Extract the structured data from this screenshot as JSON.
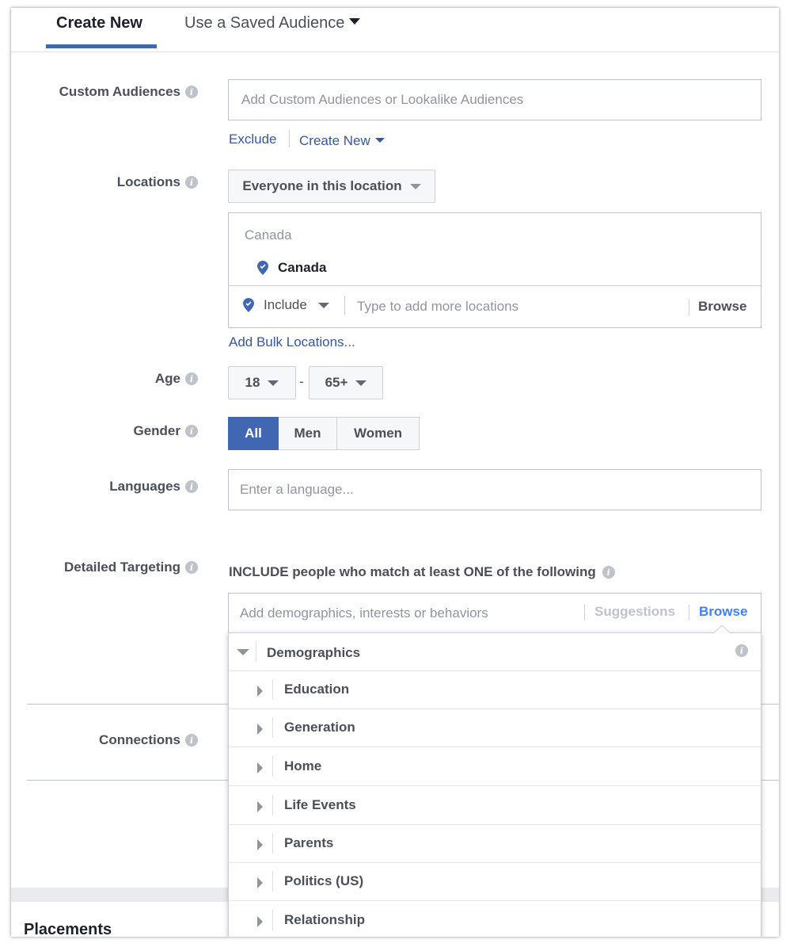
{
  "tabs": {
    "create_new": "Create New",
    "saved_audience": "Use a Saved Audience"
  },
  "custom_audiences": {
    "label": "Custom Audiences",
    "placeholder": "Add Custom Audiences or Lookalike Audiences",
    "exclude_link": "Exclude",
    "create_new_link": "Create New"
  },
  "locations": {
    "label": "Locations",
    "dropdown_value": "Everyone in this location",
    "group_header": "Canada",
    "selected_location": "Canada",
    "include_value": "Include",
    "input_placeholder": "Type to add more locations",
    "browse_label": "Browse",
    "bulk_link": "Add Bulk Locations..."
  },
  "age": {
    "label": "Age",
    "min": "18",
    "separator": "-",
    "max": "65+"
  },
  "gender": {
    "label": "Gender",
    "options": [
      "All",
      "Men",
      "Women"
    ],
    "selected": "All"
  },
  "languages": {
    "label": "Languages",
    "placeholder": "Enter a language..."
  },
  "detailed_targeting": {
    "label": "Detailed Targeting",
    "include_text": "INCLUDE people who match at least ONE of the following",
    "placeholder": "Add demographics, interests or behaviors",
    "suggestions_label": "Suggestions",
    "browse_label": "Browse",
    "category": "Demographics",
    "subcategories": [
      "Education",
      "Generation",
      "Home",
      "Life Events",
      "Parents",
      "Politics (US)",
      "Relationship"
    ]
  },
  "connections": {
    "label": "Connections"
  },
  "placements": {
    "label": "Placements"
  },
  "colors": {
    "accent": "#4267b2",
    "link": "#365899",
    "browse_active": "#4080ff"
  }
}
